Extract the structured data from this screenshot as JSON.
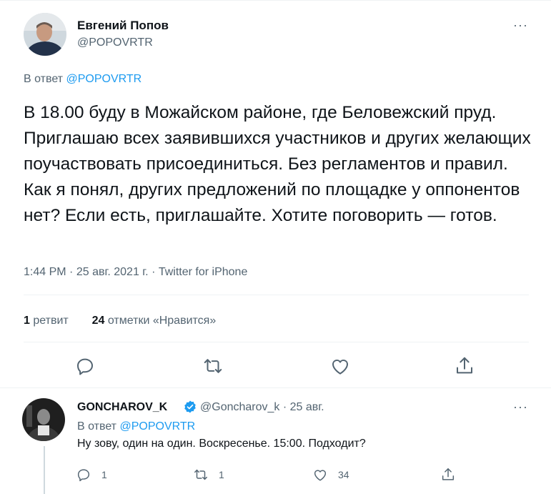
{
  "tweet": {
    "author_name": "Евгений Попов",
    "author_handle": "@POPOVRTR",
    "reply_prefix": "В ответ",
    "reply_to": "@POPOVRTR",
    "text": "В 18.00 буду в Можайском районе, где Беловежский пруд. Приглашаю всех заявившихся участников и других желающих поучаствовать присоединиться. Без регламентов и правил. Как я понял, других предложений по площадке у оппонентов нет? Если есть, приглашайте. Хотите поговорить — готов.",
    "time": "1:44 PM",
    "date": "25 авг. 2021 г.",
    "source": "Twitter for iPhone",
    "separator": "·",
    "retweets_count": "1",
    "retweets_label": "ретвит",
    "likes_count": "24",
    "likes_label": "отметки «Нравится»",
    "more_label": "···"
  },
  "reply": {
    "author_name": "GONCHAROV_K",
    "author_handle": "@Goncharov_k",
    "date": "25 авг.",
    "separator": "·",
    "reply_prefix": "В ответ",
    "reply_to": "@POPOVRTR",
    "text": "Ну зову, один на один. Воскресенье. 15:00. Подходит?",
    "reply_count": "1",
    "retweet_count": "1",
    "like_count": "34",
    "more_label": "···"
  },
  "icons": {
    "reply": "reply-icon",
    "retweet": "retweet-icon",
    "like": "heart-icon",
    "share": "share-icon",
    "verified": "verified-badge-icon",
    "more": "more-icon"
  },
  "colors": {
    "accent": "#1d9bf0",
    "secondary_text": "#536471",
    "primary_text": "#0f1419",
    "divider": "#eff3f4"
  }
}
